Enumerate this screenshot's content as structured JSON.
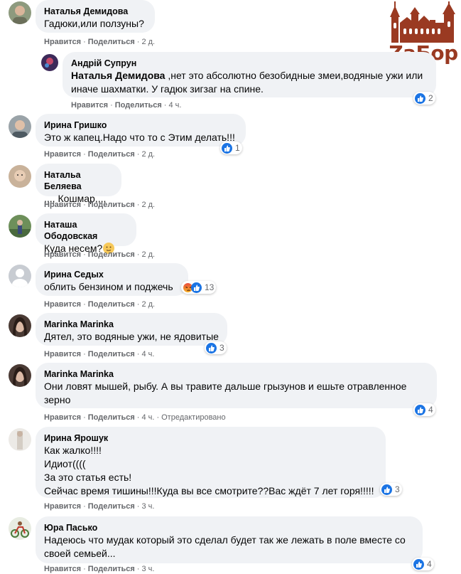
{
  "logo": {
    "text": "ZаБор",
    "color": "#9a3a22"
  },
  "actions": {
    "like": "Нравится",
    "reply": "Поделиться",
    "edited": "Отредактировано"
  },
  "comments": [
    {
      "name": "Наталья Демидова",
      "text": "Гадюки,или ползуны?",
      "time": "2 д."
    },
    {
      "name": "Андрій Супрун",
      "mention": "Наталья Демидова",
      "text": " ,нет это абсолютно безобидные змеи,водяные ужи или\nиначе шахматки. У гадюк зигзаг на спине.",
      "time": "4 ч.",
      "reactions": "2"
    },
    {
      "name": "Ирина Гришко",
      "text": "Это ж капец.Надо что то с Этим делать!!!",
      "time": "2 д.",
      "reactions": "1"
    },
    {
      "name": "Натальа Беляева",
      "text": ",,,, Кошмар,,,,",
      "time": "2 д."
    },
    {
      "name": "Наташа Ободовская",
      "text": "Куда несем?",
      "time": "2 д."
    },
    {
      "name": "Ирина Седых",
      "text": "облить бензином и поджечь",
      "time": "2 д.",
      "reactions": "13"
    },
    {
      "name": "Marinka Marinka",
      "text": "Дятел, это водяные ужи, не ядовитые",
      "time": "4 ч.",
      "reactions": "3"
    },
    {
      "name": "Marinka Marinka",
      "text": "Они ловят мышей, рыбу. А вы травите дальше грызунов и ешьте отравленное\nзерно",
      "time": "4 ч.",
      "reactions": "4"
    },
    {
      "name": "Ирина Ярошук",
      "text": "Как жалко!!!!\nИдиот((((\nЗа это статья есть!\nСейчас время тишины!!!Куда вы все смотрите??Вас ждёт 7 лет горя!!!!!",
      "time": "3 ч.",
      "reactions": "3"
    },
    {
      "name": "Юра Пасько",
      "text": "Надеюсь что мудак который это сделал будет так же лежать в поле вместе со\nсвоей семьей...",
      "time": "3 ч.",
      "reactions": "4"
    }
  ],
  "colors": {
    "bubble": "#f0f2f5",
    "meta": "#65676b",
    "like": "#1b74e4"
  }
}
